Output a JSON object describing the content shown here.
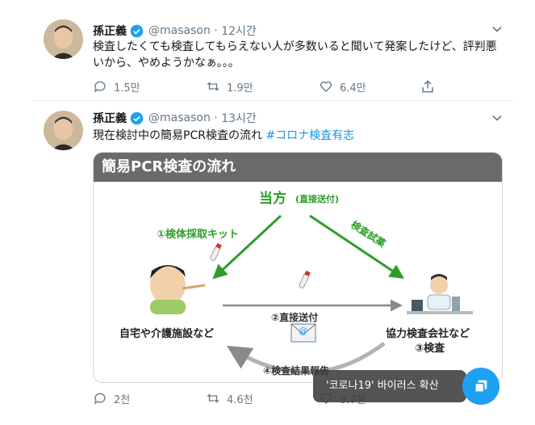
{
  "tweets": [
    {
      "name": "孫正義",
      "handle": "@masason",
      "time": "12시간",
      "text": "検査したくても検査してもらえない人が多数いると聞いて発案したけど、評判悪いから、やめようかなぁ。。。",
      "replies": "1.5만",
      "retweets": "1.9만",
      "likes": "6.4만"
    },
    {
      "name": "孫正義",
      "handle": "@masason",
      "time": "13시간",
      "text": "現在検討中の簡易PCR検査の流れ ",
      "hashtag": "#コロナ検査有志",
      "replies": "2천",
      "retweets": "4.6천",
      "likes": "9.7천"
    }
  ],
  "diagram": {
    "title": "簡易PCR検査の流れ",
    "party": "当方",
    "party_note": "(直接送付)",
    "step1": "①検体採取キット",
    "step_test_kit": "検査試薬",
    "step2": "②直接送付",
    "step4": "④検査結果報告",
    "home": "自宅や介護施設など",
    "lab": "協力検査会社など",
    "step3": "③検査",
    "mail_symbol": "@"
  },
  "toast": {
    "text": "'코로나19' 바이러스 확산"
  },
  "colors": {
    "accent": "#1da1f2",
    "green": "#2e9e2a",
    "grey_text": "#657786",
    "arrow_grey": "#8a8a8a"
  }
}
